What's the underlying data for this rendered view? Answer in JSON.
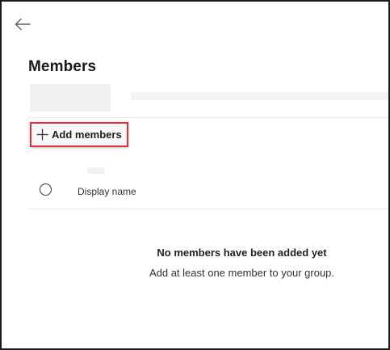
{
  "header": {
    "back_icon": "arrow-left-icon",
    "title": "Members"
  },
  "toolbar": {
    "add_members_icon": "plus-icon",
    "add_members_label": "Add members",
    "highlight_color": "#e0303a"
  },
  "table": {
    "select_all_icon": "radio-circle-icon",
    "columns": [
      "Display name"
    ]
  },
  "empty_state": {
    "title": "No members have been added yet",
    "subtitle": "Add at least one member to your group."
  }
}
